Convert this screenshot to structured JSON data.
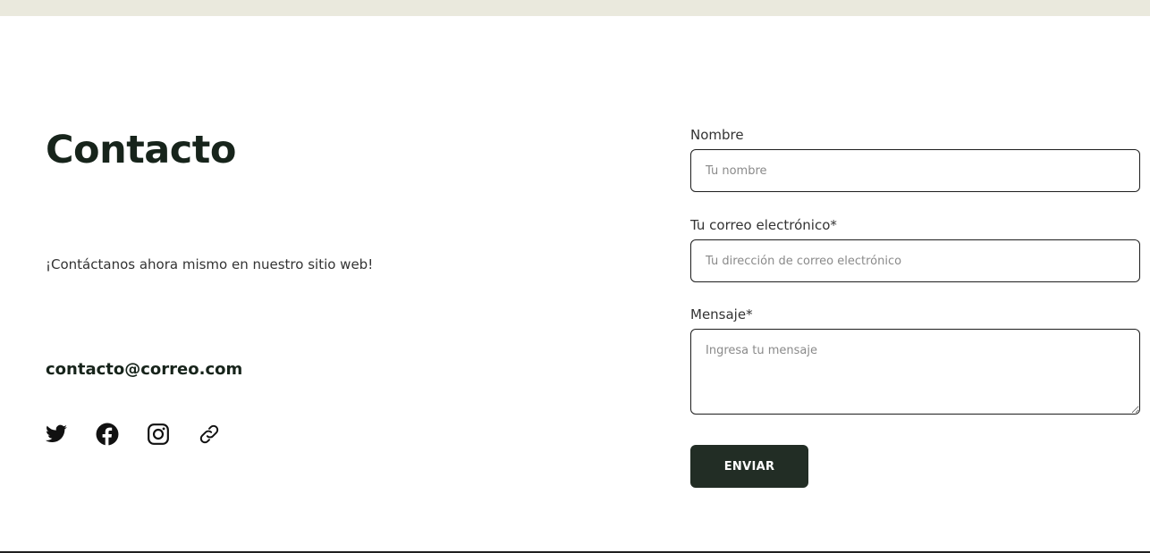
{
  "contact": {
    "title": "Contacto",
    "intro": "¡Contáctanos ahora mismo en nuestro sitio web!",
    "email": "contacto@correo.com",
    "social_icons": [
      "twitter-icon",
      "facebook-icon",
      "instagram-icon",
      "link-icon"
    ]
  },
  "form": {
    "name_label": "Nombre",
    "name_placeholder": "Tu nombre",
    "email_label": "Tu correo electrónico*",
    "email_placeholder": "Tu dirección de correo electrónico",
    "message_label": "Mensaje*",
    "message_placeholder": "Ingresa tu mensaje",
    "submit_label": "ENVIAR"
  },
  "colors": {
    "top_strip": "#eae9dd",
    "heading": "#17241b",
    "button_bg": "#222d25",
    "input_border": "#1d1d1d"
  }
}
